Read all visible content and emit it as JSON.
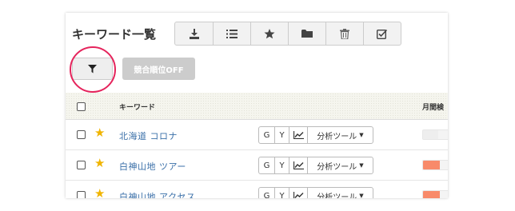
{
  "page": {
    "title": "キーワード一覧"
  },
  "toolbar": {
    "buttons": [
      {
        "icon": "download-icon"
      },
      {
        "icon": "list-icon"
      },
      {
        "icon": "star-icon"
      },
      {
        "icon": "folder-icon"
      },
      {
        "icon": "trash-icon"
      },
      {
        "icon": "checkbox-icon"
      }
    ]
  },
  "filter": {
    "icon": "filter-icon",
    "competitor_label": "競合順位OFF"
  },
  "table": {
    "headers": {
      "keyword": "キーワード",
      "monthly": "月間検"
    },
    "rows": [
      {
        "keyword": "北海道 コロナ",
        "starred": true,
        "volume_fill": 0.5,
        "volume_color": "#eeeeee"
      },
      {
        "keyword": "白神山地 ツアー",
        "starred": true,
        "volume_fill": 0.55,
        "volume_color": "#f88a6a"
      },
      {
        "keyword": "白神山地 アクセス",
        "starred": true,
        "volume_fill": 0.55,
        "volume_color": "#f88a6a"
      }
    ],
    "row_buttons": {
      "g": "G",
      "y": "Y",
      "chart_icon": "chart-line-icon",
      "tool": "分析ツール"
    }
  },
  "colors": {
    "highlight": "#e5245c",
    "link": "#3a6fa8",
    "star": "#f0b400"
  }
}
